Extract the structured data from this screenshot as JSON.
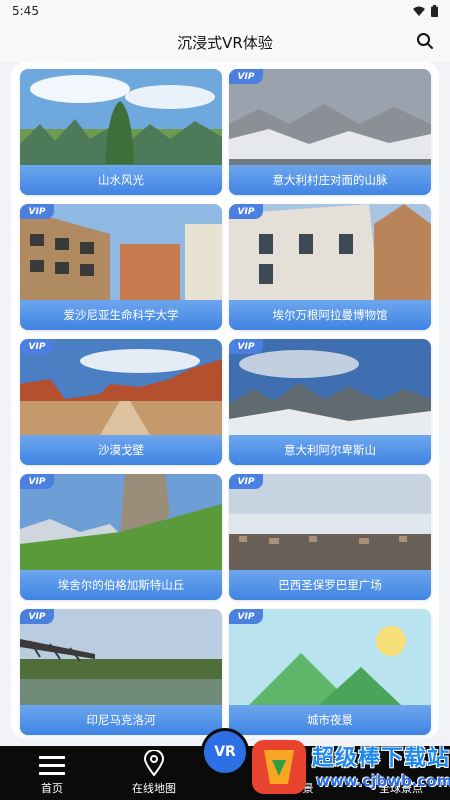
{
  "status_bar": {
    "time": "5:45"
  },
  "header": {
    "title": "沉浸式VR体验",
    "search_icon": "search-icon"
  },
  "vip_badge": "VIP",
  "cards": [
    {
      "label": "山水风光",
      "vip": false
    },
    {
      "label": "意大利村庄对面的山脉",
      "vip": true
    },
    {
      "label": "爱沙尼亚生命科学大学",
      "vip": true
    },
    {
      "label": "埃尔万根阿拉曼博物馆",
      "vip": true
    },
    {
      "label": "沙漠戈壁",
      "vip": true
    },
    {
      "label": "意大利阿尔卑斯山",
      "vip": true
    },
    {
      "label": "埃舍尔的伯格加斯特山丘",
      "vip": true
    },
    {
      "label": "巴西圣保罗巴里广场",
      "vip": true
    },
    {
      "label": "印尼马克洛河",
      "vip": true
    },
    {
      "label": "城市夜景",
      "vip": true
    }
  ],
  "bottom_nav": {
    "home": "首页",
    "map": "在线地图",
    "vr": "VR",
    "item3": "景",
    "item4": "全球景点"
  },
  "watermark": {
    "title": "超级棒下载站",
    "url": "www.cjbwb.com"
  },
  "colors": {
    "accent": "#3f84e3",
    "nav_bg": "#0b0b0b",
    "vr_button": "#2f6fe6"
  }
}
